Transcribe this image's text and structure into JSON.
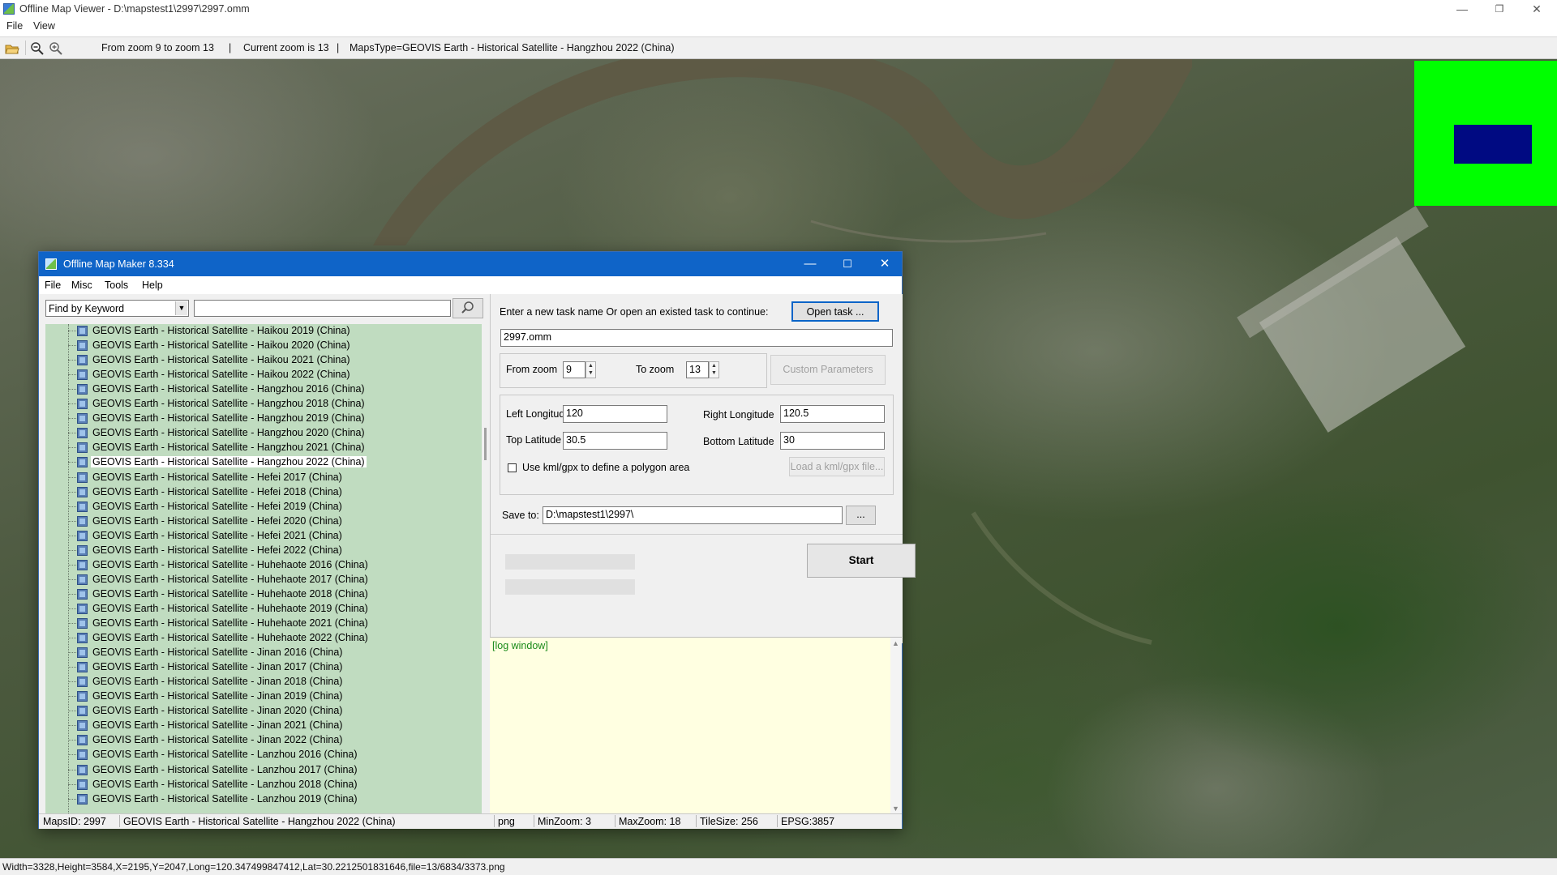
{
  "viewer": {
    "title": "Offline Map Viewer - D:\\mapstest1\\2997\\2997.omm",
    "menu": [
      "File",
      "View"
    ],
    "toolbar": {
      "zoom_range": "From zoom 9 to zoom 13",
      "current_zoom": "Current zoom is 13",
      "maps_type": "MapsType=GEOVIS Earth - Historical Satellite - Hangzhou 2022 (China)"
    },
    "status": "Width=3328,Height=3584,X=2195,Y=2047,Long=120.347499847412,Lat=30.2212501831646,file=13/6834/3373.png",
    "minimap_colors": {
      "background": "#00ff00",
      "viewport": "#000a82"
    }
  },
  "dialog": {
    "title": "Offline Map Maker 8.334",
    "menu": [
      "File",
      "Misc",
      "Tools",
      "Help"
    ],
    "find_mode": "Find by Keyword",
    "search_value": "",
    "tree_items": [
      "GEOVIS Earth - Historical Satellite - Haikou 2019 (China)",
      "GEOVIS Earth - Historical Satellite - Haikou 2020 (China)",
      "GEOVIS Earth - Historical Satellite - Haikou 2021 (China)",
      "GEOVIS Earth - Historical Satellite - Haikou 2022 (China)",
      "GEOVIS Earth - Historical Satellite - Hangzhou 2016 (China)",
      "GEOVIS Earth - Historical Satellite - Hangzhou 2018 (China)",
      "GEOVIS Earth - Historical Satellite - Hangzhou 2019 (China)",
      "GEOVIS Earth - Historical Satellite - Hangzhou 2020 (China)",
      "GEOVIS Earth - Historical Satellite - Hangzhou 2021 (China)",
      "GEOVIS Earth - Historical Satellite - Hangzhou 2022 (China)",
      "GEOVIS Earth - Historical Satellite - Hefei 2017 (China)",
      "GEOVIS Earth - Historical Satellite - Hefei 2018 (China)",
      "GEOVIS Earth - Historical Satellite - Hefei 2019 (China)",
      "GEOVIS Earth - Historical Satellite - Hefei 2020 (China)",
      "GEOVIS Earth - Historical Satellite - Hefei 2021 (China)",
      "GEOVIS Earth - Historical Satellite - Hefei 2022 (China)",
      "GEOVIS Earth - Historical Satellite - Huhehaote 2016 (China)",
      "GEOVIS Earth - Historical Satellite - Huhehaote 2017 (China)",
      "GEOVIS Earth - Historical Satellite - Huhehaote 2018 (China)",
      "GEOVIS Earth - Historical Satellite - Huhehaote 2019 (China)",
      "GEOVIS Earth - Historical Satellite - Huhehaote 2021 (China)",
      "GEOVIS Earth - Historical Satellite - Huhehaote 2022 (China)",
      "GEOVIS Earth - Historical Satellite - Jinan 2016 (China)",
      "GEOVIS Earth - Historical Satellite - Jinan 2017 (China)",
      "GEOVIS Earth - Historical Satellite - Jinan 2018 (China)",
      "GEOVIS Earth - Historical Satellite - Jinan 2019 (China)",
      "GEOVIS Earth - Historical Satellite - Jinan 2020 (China)",
      "GEOVIS Earth - Historical Satellite - Jinan 2021 (China)",
      "GEOVIS Earth - Historical Satellite - Jinan 2022 (China)",
      "GEOVIS Earth - Historical Satellite - Lanzhou 2016 (China)",
      "GEOVIS Earth - Historical Satellite - Lanzhou 2017 (China)",
      "GEOVIS Earth - Historical Satellite - Lanzhou 2018 (China)",
      "GEOVIS Earth - Historical Satellite - Lanzhou 2019 (China)"
    ],
    "selected_item": "GEOVIS Earth - Historical Satellite - Hangzhou 2022 (China)",
    "task": {
      "prompt": "Enter a new task name Or open an existed task to continue:",
      "open_label": "Open task ...",
      "name": "2997.omm"
    },
    "zoom": {
      "from_label": "From zoom",
      "from_value": "9",
      "to_label": "To zoom",
      "to_value": "13",
      "custom_label": "Custom Parameters"
    },
    "coords": {
      "left_label": "Left Longitude",
      "left_value": "120",
      "right_label": "Right Longitude",
      "right_value": "120.5",
      "top_label": "Top Latitude",
      "top_value": "30.5",
      "bottom_label": "Bottom Latitude",
      "bottom_value": "30",
      "polygon_label": "Use kml/gpx to define a polygon area",
      "polygon_checked": false,
      "load_label": "Load a kml/gpx file..."
    },
    "save": {
      "label": "Save to:",
      "path": "D:\\mapstest1\\2997\\",
      "browse": "..."
    },
    "start_label": "Start",
    "log_text": "[log window]",
    "status": {
      "maps_id": "MapsID: 2997",
      "maps_name": "GEOVIS Earth - Historical Satellite - Hangzhou 2022 (China)",
      "format": "png",
      "min_zoom": "MinZoom: 3",
      "max_zoom": "MaxZoom: 18",
      "tile_size": "TileSize: 256",
      "epsg": "EPSG:3857"
    }
  }
}
